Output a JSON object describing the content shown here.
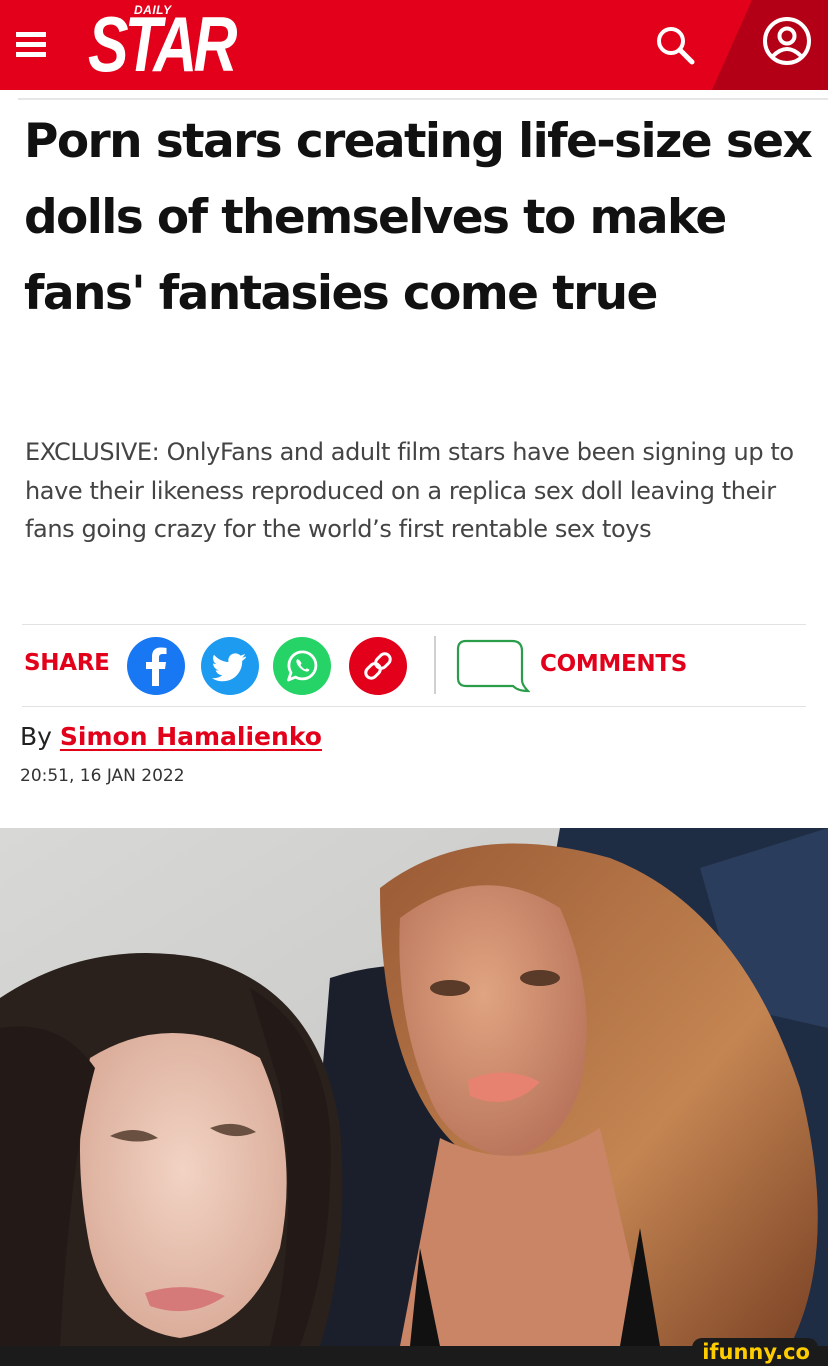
{
  "brand": {
    "small_word": "DAILY",
    "name": "STAR",
    "primary_color": "#e2001a",
    "secondary_color": "#b40016"
  },
  "header": {
    "menu_icon": "hamburger-menu-icon",
    "search_icon": "search-icon",
    "account_icon": "account-icon"
  },
  "article": {
    "headline": "Porn stars creating life-size sex dolls of themselves to make fans' fantasies come true",
    "standfirst": "EXCLUSIVE: OnlyFans and adult film stars have been signing up to have their likeness reproduced on a replica sex doll leaving their fans going crazy for the world’s first rentable sex toys",
    "share": {
      "label": "SHARE",
      "buttons": [
        {
          "icon": "facebook-icon",
          "color": "#1877f2"
        },
        {
          "icon": "twitter-icon",
          "color": "#1d9bf0"
        },
        {
          "icon": "whatsapp-icon",
          "color": "#25d366"
        },
        {
          "icon": "link-icon",
          "color": "#e2001a"
        }
      ]
    },
    "comments": {
      "label": "COMMENTS",
      "icon": "comment-bubble-icon"
    },
    "byline": {
      "prefix": "By",
      "author": "Simon Hamalienko"
    },
    "timestamp": "20:51, 16 JAN 2022"
  },
  "watermark": {
    "text": "ifunny.co"
  }
}
